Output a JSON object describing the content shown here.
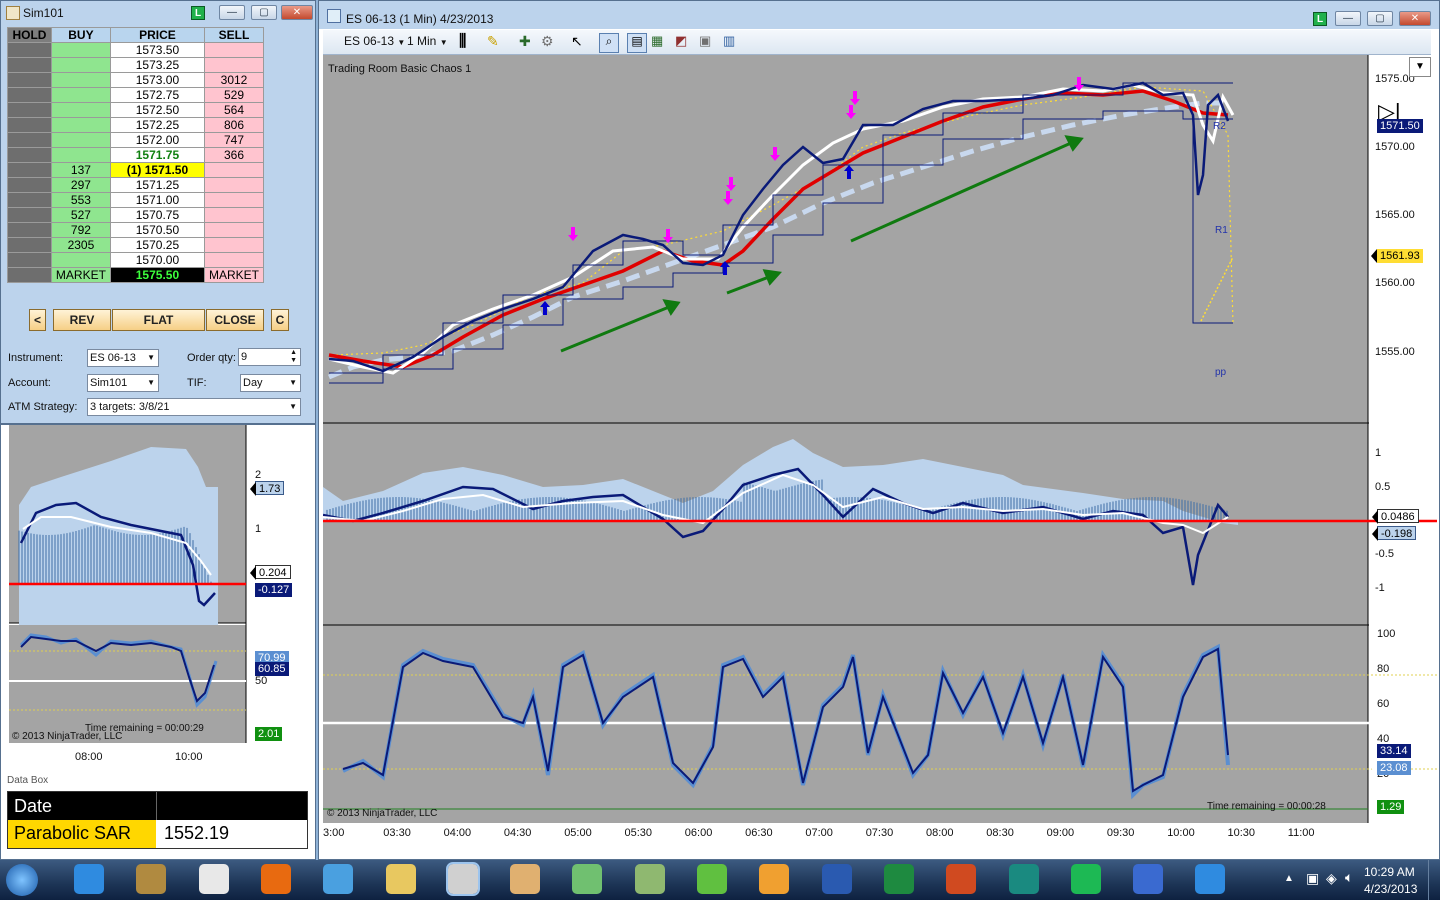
{
  "dom_window": {
    "title": "Sim101",
    "headers": [
      "HOLD",
      "BUY",
      "PRICE",
      "SELL"
    ],
    "rows": [
      {
        "buy": "",
        "price": "1573.50",
        "sell": ""
      },
      {
        "buy": "",
        "price": "1573.25",
        "sell": ""
      },
      {
        "buy": "",
        "price": "1573.00",
        "sell": "3012"
      },
      {
        "buy": "",
        "price": "1572.75",
        "sell": "529"
      },
      {
        "buy": "",
        "price": "1572.50",
        "sell": "564"
      },
      {
        "buy": "",
        "price": "1572.25",
        "sell": "806"
      },
      {
        "buy": "",
        "price": "1572.00",
        "sell": "747"
      },
      {
        "buy": "",
        "price": "1571.75",
        "sell": "366"
      },
      {
        "buy": "137",
        "price": "(1) 1571.50",
        "sell": ""
      },
      {
        "buy": "297",
        "price": "1571.25",
        "sell": ""
      },
      {
        "buy": "553",
        "price": "1571.00",
        "sell": ""
      },
      {
        "buy": "527",
        "price": "1570.75",
        "sell": ""
      },
      {
        "buy": "792",
        "price": "1570.50",
        "sell": ""
      },
      {
        "buy": "2305",
        "price": "1570.25",
        "sell": ""
      },
      {
        "buy": "",
        "price": "1570.00",
        "sell": ""
      }
    ],
    "market_buy": "MARKET",
    "market_price": "1575.50",
    "market_sell": "MARKET",
    "buttons": {
      "left": "<",
      "rev": "REV",
      "flat": "FLAT",
      "close": "CLOSE",
      "c": "C"
    },
    "instrument_label": "Instrument:",
    "instrument_value": "ES 06-13",
    "order_qty_label": "Order qty:",
    "order_qty_value": "9",
    "account_label": "Account:",
    "account_value": "Sim101",
    "tif_label": "TIF:",
    "tif_value": "Day",
    "atm_label": "ATM Strategy:",
    "atm_value": "3 targets: 3/8/21"
  },
  "mini_chart": {
    "macd_ticks": [
      "2",
      "1"
    ],
    "macd_tags": [
      "1.73",
      "0.204",
      "-0.127"
    ],
    "stoch_tags": [
      "70.99",
      "60.85",
      "2.01"
    ],
    "stoch_tick": "50",
    "copyright": "© 2013 NinjaTrader, LLC",
    "time_remaining": "Time remaining = 00:00:29",
    "x_ticks": [
      "08:00",
      "10:00"
    ]
  },
  "data_box": {
    "title": "Data Box",
    "rows": [
      {
        "label": "Date",
        "value": ""
      },
      {
        "label": "Parabolic SAR",
        "value": "1552.19"
      }
    ]
  },
  "chart_window": {
    "title": "ES 06-13 (1 Min)  4/23/2013",
    "toolbar_instrument": "ES 06-13",
    "toolbar_period": "1 Min",
    "template_name": "Trading Room Basic Chaos 1",
    "price_ticks": [
      "1575.00",
      "1570.00",
      "1565.00",
      "1560.00",
      "1555.00"
    ],
    "price_tags": [
      "1571.50",
      "1561.93"
    ],
    "pivot_labels": [
      "R2",
      "R1",
      "PP"
    ],
    "macd_ticks": [
      "1",
      "0.5",
      "-0.5",
      "-1"
    ],
    "macd_tags": [
      "0.0486",
      "-0.198"
    ],
    "stoch_ticks": [
      "100",
      "80",
      "60",
      "40",
      "20"
    ],
    "stoch_tags": [
      "33.14",
      "23.08",
      "1.29"
    ],
    "copyright": "© 2013 NinjaTrader, LLC",
    "time_remaining": "Time remaining = 00:00:28",
    "x_ticks": [
      "3:00",
      "03:30",
      "04:00",
      "04:30",
      "05:00",
      "05:30",
      "06:00",
      "06:30",
      "07:00",
      "07:30",
      "08:00",
      "08:30",
      "09:00",
      "09:30",
      "10:00",
      "10:30",
      "11:00"
    ]
  },
  "taskbar": {
    "apps": [
      "start",
      "internet-explorer",
      "game",
      "notepad",
      "media-player",
      "messenger",
      "file-explorer",
      "ninjatrader",
      "compass",
      "network",
      "money",
      "games",
      "outlook",
      "word",
      "excel",
      "powerpoint",
      "publisher",
      "spotify",
      "flower",
      "internet-explorer-2"
    ],
    "clock_time": "10:29 AM",
    "clock_date": "4/23/2013"
  },
  "colors": {
    "panel_bg": "#a4a4a4",
    "up_arrow": "#0000cc",
    "down_arrow": "#ff00ff",
    "trend_arrow": "#107a10",
    "zero_line": "#ff0000",
    "price_line": "#0a1a78",
    "ema_red": "#e00000",
    "ema_white": "#ffffff",
    "ema_dashed": "#c8d8ee"
  }
}
